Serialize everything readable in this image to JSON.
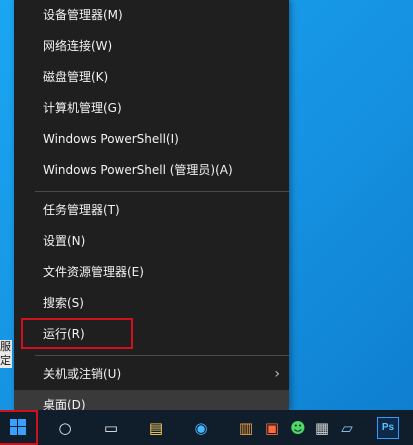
{
  "menu": {
    "items": [
      {
        "label": "设备管理器(M)"
      },
      {
        "label": "网络连接(W)"
      },
      {
        "label": "磁盘管理(K)"
      },
      {
        "label": "计算机管理(G)"
      },
      {
        "label": "Windows PowerShell(I)"
      },
      {
        "label": "Windows PowerShell (管理员)(A)"
      },
      {
        "label": "任务管理器(T)"
      },
      {
        "label": "设置(N)"
      },
      {
        "label": "文件资源管理器(E)"
      },
      {
        "label": "搜索(S)"
      },
      {
        "label": "运行(R)"
      },
      {
        "label": "关机或注销(U)",
        "submenu_icon": "chevron-right-icon",
        "chevron": "›"
      },
      {
        "label": "桌面(D)"
      }
    ]
  },
  "desktop": {
    "partial_text": [
      "服",
      "定"
    ]
  },
  "taskbar": {
    "icons": [
      {
        "name": "start-windows-icon"
      },
      {
        "name": "cortana-icon",
        "glyph": "○"
      },
      {
        "name": "task-view-icon",
        "glyph": "▭"
      },
      {
        "name": "app-icon",
        "glyph": "▤"
      },
      {
        "name": "browser-icon",
        "glyph": "◉"
      },
      {
        "name": "app-icon",
        "glyph": "▥"
      },
      {
        "name": "app-icon",
        "glyph": "▣"
      },
      {
        "name": "wechat-icon",
        "glyph": "☻"
      },
      {
        "name": "app-icon",
        "glyph": "▦"
      },
      {
        "name": "notepad-icon",
        "glyph": "▱"
      },
      {
        "name": "photoshop-icon",
        "label": "Ps"
      }
    ]
  },
  "colors": {
    "menu_bg": "#1f1f1f",
    "menu_text": "#f2f2f2",
    "highlight": "#d0111b",
    "desktop": "#1598e6",
    "taskbar": "#101d2a"
  }
}
